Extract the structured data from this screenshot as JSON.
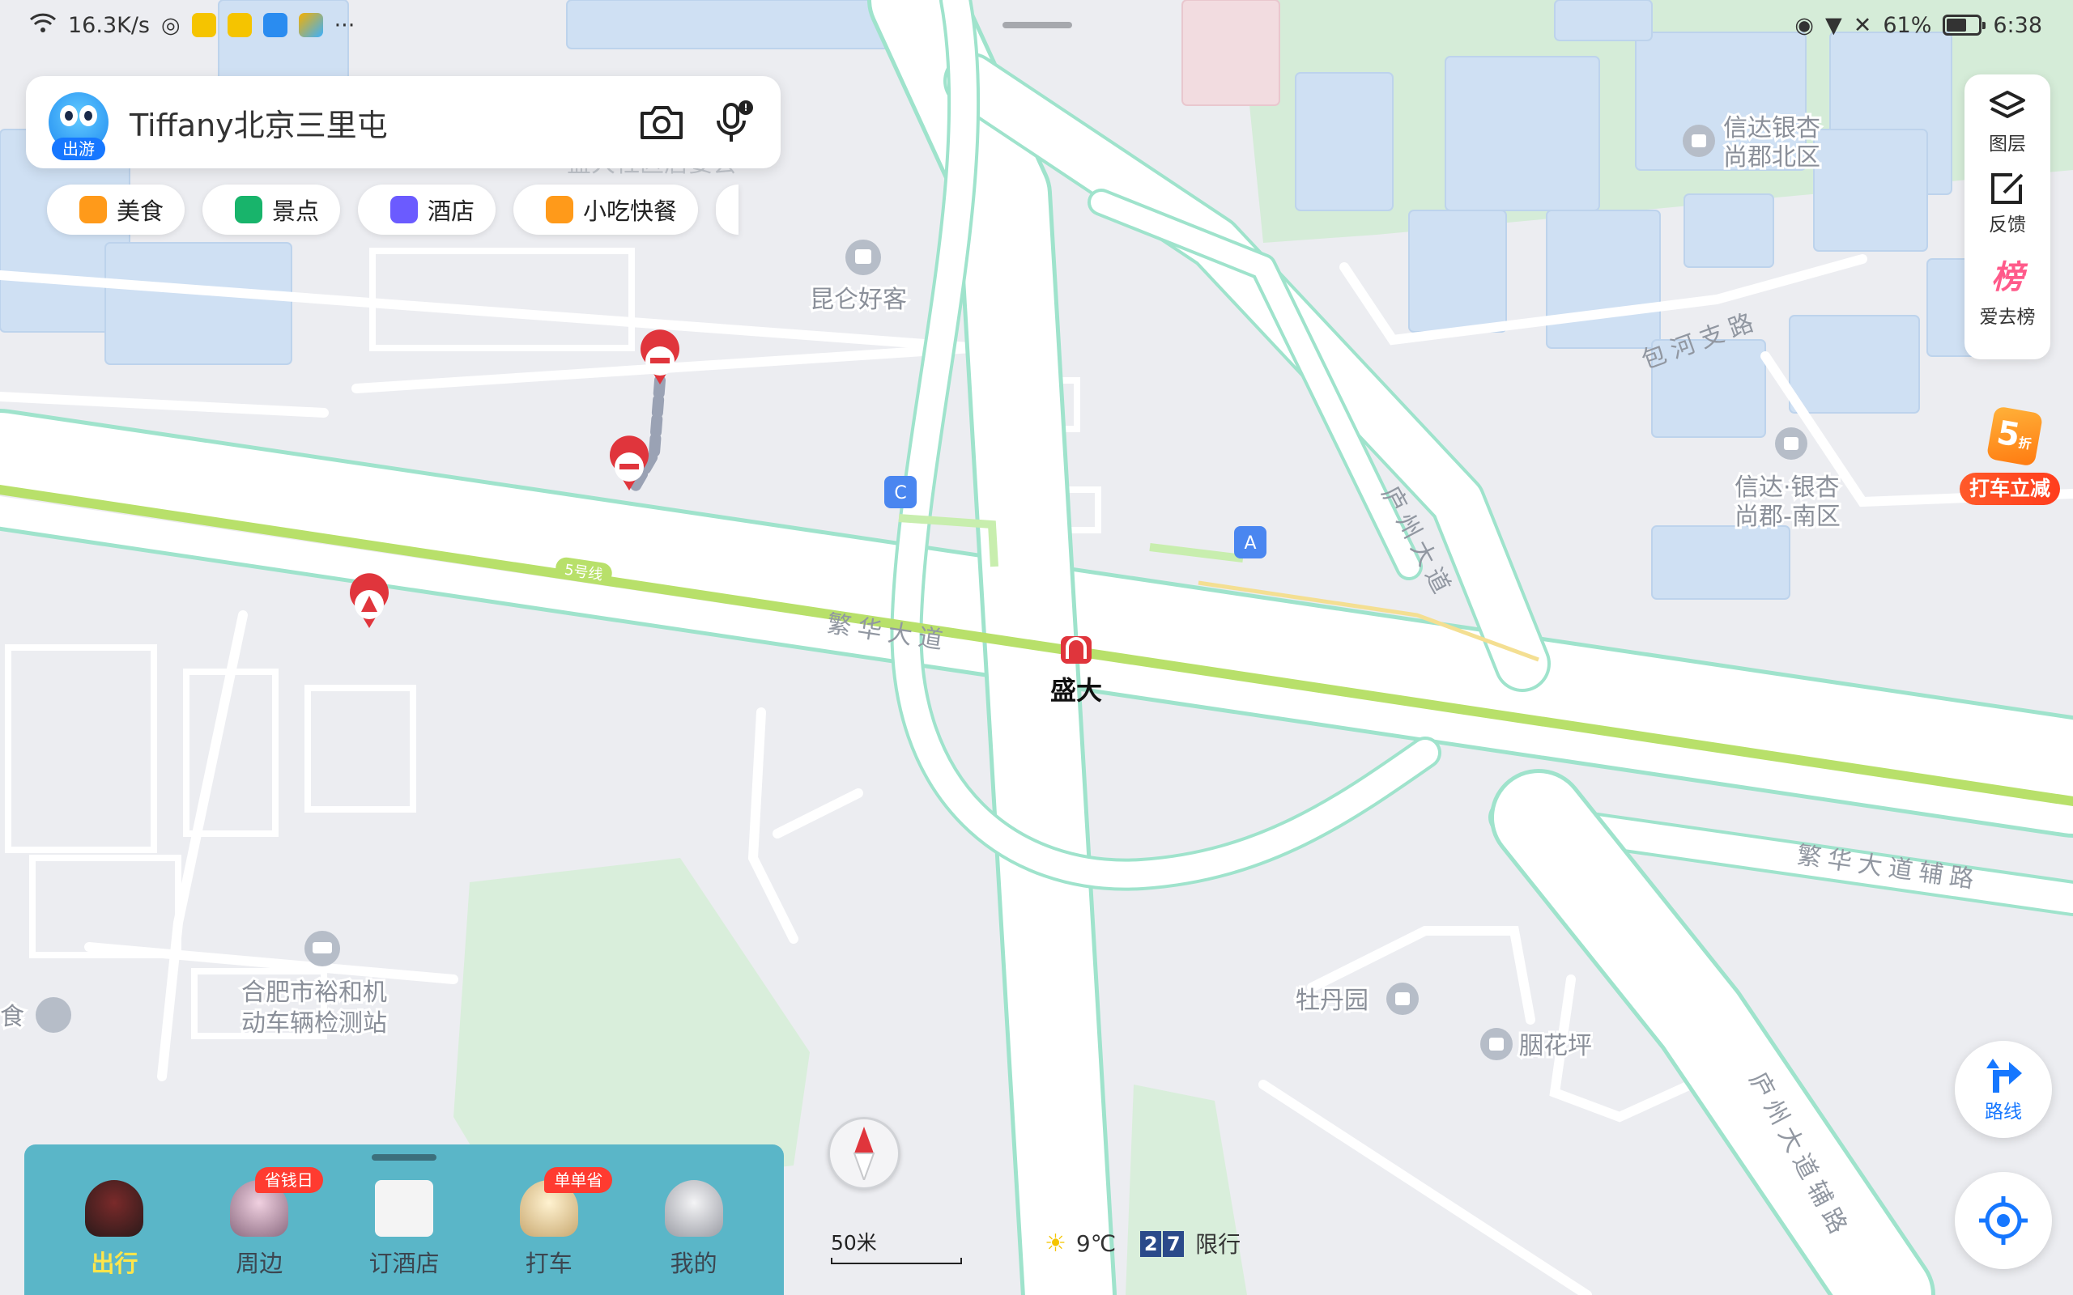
{
  "status_bar": {
    "network_speed": "16.3K/s",
    "more": "···",
    "battery_level": "61%",
    "battery_fraction": 0.61,
    "time": "6:38"
  },
  "search": {
    "avatar_tag": "出游",
    "query": "Tiffany北京三里屯"
  },
  "categories": [
    {
      "label": "美食",
      "color": "#ff9a1a"
    },
    {
      "label": "景点",
      "color": "#18b46b"
    },
    {
      "label": "酒店",
      "color": "#6b5bff"
    },
    {
      "label": "小吃快餐",
      "color": "#ff9a1a"
    }
  ],
  "right_tools": {
    "layers": "图层",
    "feedback": "反馈",
    "ranking_icon": "榜",
    "ranking": "爱去榜"
  },
  "promo": {
    "discount": "5",
    "discount_unit": "折",
    "label": "打车立减"
  },
  "map_labels": {
    "poi_kunlun": "昆仑好客",
    "poi_xinda_north": "信达银杏\n尚郡北区",
    "poi_xinda_south": "信达·银杏\n尚郡-南区",
    "poi_vehicle_test": "合肥市裕和机\n动车辆检测站",
    "poi_food_partial": "食",
    "poi_mudan": "牡丹园",
    "poi_yanhua": "胭花坪",
    "station": "盛大",
    "road_fanhua": "繁华大道",
    "road_fanhua_aux": "繁华大道辅路",
    "road_baohe": "包河支路",
    "road_luzhou": "庐州大道",
    "road_luzhou_aux": "庐州大道辅路",
    "metro_line": "5号线",
    "exit_a": "A",
    "exit_c": "C",
    "hidden_partial": "盛大社区居委会"
  },
  "route_button": "路线",
  "scale": "50米",
  "weather": {
    "temperature": "9℃",
    "plate_a": "2",
    "plate_b": "7",
    "restriction": "限行"
  },
  "bottom_nav": {
    "items": [
      {
        "label": "出行",
        "active": true,
        "badge": ""
      },
      {
        "label": "周边",
        "active": false,
        "badge": "省钱日"
      },
      {
        "label": "订酒店",
        "active": false,
        "badge": ""
      },
      {
        "label": "打车",
        "active": false,
        "badge": "单单省"
      },
      {
        "label": "我的",
        "active": false,
        "badge": ""
      }
    ]
  },
  "colors": {
    "accent": "#1677ff",
    "metro_line": "#b8e06a",
    "road_edge": "#9fe3cc",
    "nav_bg": "#5ab6c8",
    "active_label": "#ffe54a"
  }
}
